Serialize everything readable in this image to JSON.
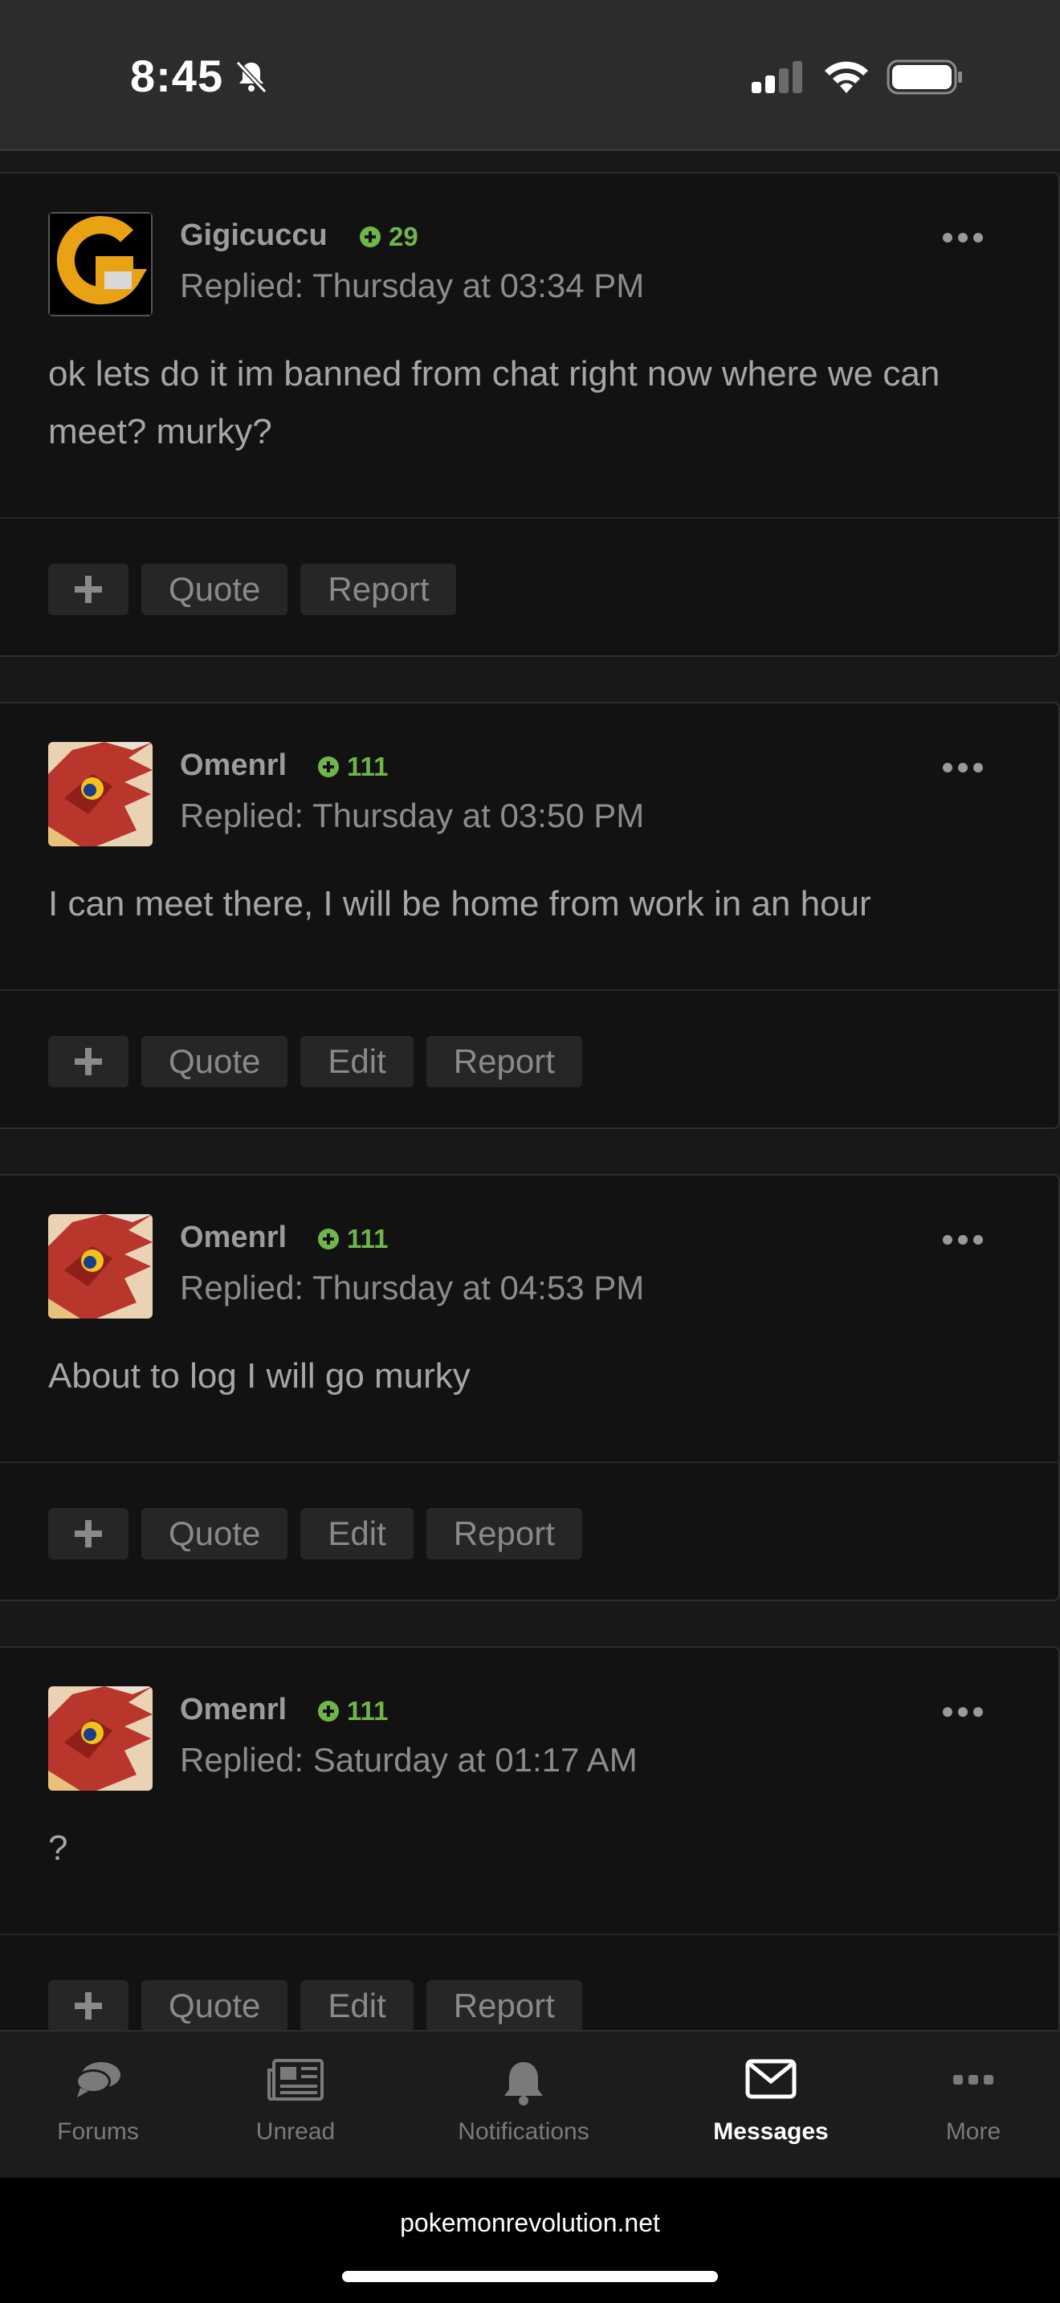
{
  "status_bar": {
    "time": "8:45",
    "icons": [
      "bell-slash-icon",
      "cellular-signal-icon",
      "wifi-icon",
      "battery-icon"
    ]
  },
  "posts": [
    {
      "author": "Gigicuccu",
      "reaction_score": "29",
      "replied": "Replied: Thursday at 03:34 PM",
      "body": "ok lets do it im banned from chat right now where we can meet? murky?",
      "avatar_icon": "gold-g-logo-avatar",
      "actions": [
        "Quote",
        "Report"
      ]
    },
    {
      "author": "Omenrl",
      "reaction_score": "111",
      "replied": "Replied: Thursday at 03:50 PM",
      "body": "I can meet there, I will be home from work in an hour",
      "avatar_icon": "red-bird-avatar",
      "actions": [
        "Quote",
        "Edit",
        "Report"
      ]
    },
    {
      "author": "Omenrl",
      "reaction_score": "111",
      "replied": "Replied: Thursday at 04:53 PM",
      "body": "About to log I will go murky",
      "avatar_icon": "red-bird-avatar",
      "actions": [
        "Quote",
        "Edit",
        "Report"
      ]
    },
    {
      "author": "Omenrl",
      "reaction_score": "111",
      "replied": "Replied: Saturday at 01:17 AM",
      "body": "?",
      "avatar_icon": "red-bird-avatar",
      "actions": [
        "Quote",
        "Edit",
        "Report"
      ]
    }
  ],
  "tab_bar": {
    "tabs": [
      {
        "label": "Forums",
        "icon": "chat-bubbles-icon",
        "active": false
      },
      {
        "label": "Unread",
        "icon": "newspaper-icon",
        "active": false
      },
      {
        "label": "Notifications",
        "icon": "bell-icon",
        "active": false
      },
      {
        "label": "Messages",
        "icon": "envelope-icon",
        "active": true
      },
      {
        "label": "More",
        "icon": "more-dots-icon",
        "active": false
      }
    ]
  },
  "browser": {
    "url": "pokemonrevolution.net"
  },
  "colors": {
    "background": "#181818",
    "card": "#121212",
    "reaction_green": "#6fb54a",
    "status_bar": "#2c2c2c"
  }
}
